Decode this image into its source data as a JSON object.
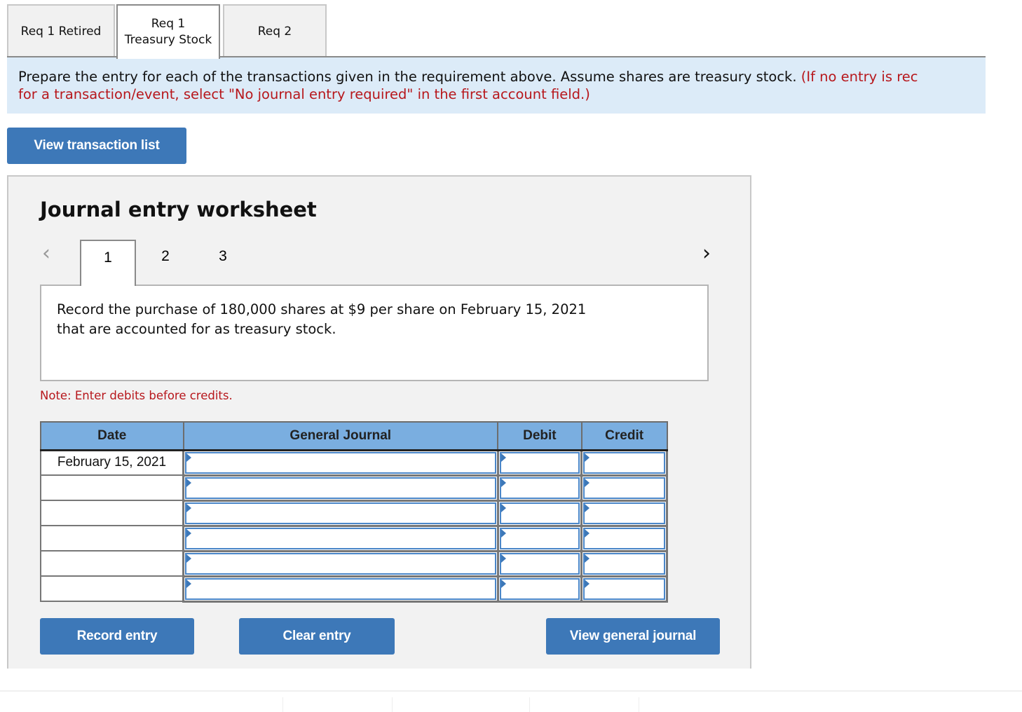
{
  "tabs": [
    {
      "label": "Req 1 Retired",
      "active": false
    },
    {
      "label_line1": "Req 1",
      "label_line2": "Treasury Stock",
      "active": true
    },
    {
      "label": "Req 2",
      "active": false
    }
  ],
  "instructions": {
    "text": "Prepare the entry for each of the transactions given in the requirement above. Assume shares are treasury stock. ",
    "red_text_line1": "(If no entry is rec",
    "red_text_line2": "for a transaction/event, select \"No journal entry required\" in the first account field.)"
  },
  "buttons": {
    "view_transaction_list": "View transaction list",
    "record_entry": "Record entry",
    "clear_entry": "Clear entry",
    "view_general_journal": "View general journal"
  },
  "worksheet": {
    "title": "Journal entry worksheet",
    "prev_icon": "‹",
    "next_icon": "›",
    "steps": [
      "1",
      "2",
      "3"
    ],
    "active_step": "1",
    "description_line1": "Record the purchase of 180,000 shares at $9 per share on February 15, 2021",
    "description_line2": "that are accounted for as treasury stock.",
    "note": "Note: Enter debits before credits."
  },
  "journal": {
    "columns": [
      "Date",
      "General Journal",
      "Debit",
      "Credit"
    ],
    "rows": [
      {
        "date": "February 15, 2021",
        "account": "",
        "debit": "",
        "credit": ""
      },
      {
        "date": "",
        "account": "",
        "debit": "",
        "credit": ""
      },
      {
        "date": "",
        "account": "",
        "debit": "",
        "credit": ""
      },
      {
        "date": "",
        "account": "",
        "debit": "",
        "credit": ""
      },
      {
        "date": "",
        "account": "",
        "debit": "",
        "credit": ""
      },
      {
        "date": "",
        "account": "",
        "debit": "",
        "credit": ""
      }
    ]
  },
  "colors": {
    "accent_blue": "#3d78b8",
    "header_blue": "#7aaee0",
    "instruction_bg": "#dcebf8",
    "alert_red": "#b7171c"
  }
}
